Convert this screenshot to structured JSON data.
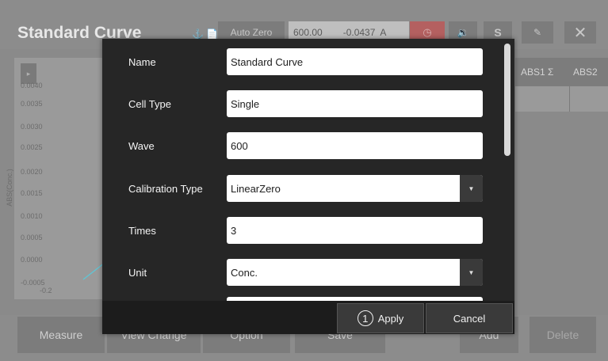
{
  "app": {
    "title": "Standard Curve",
    "header_icons": "⚓ 📄",
    "auto_zero_label": "Auto Zero",
    "wavelength_value": "600.00",
    "abs_value": "-0.0437",
    "abs_unit": "A",
    "sound_icon": "🔉",
    "s_label": "S",
    "close_glyph": "✕",
    "clock_icon": "◷",
    "edit_icon": "✎"
  },
  "chart": {
    "y_axis_label": "ABS(Conc.)",
    "y_ticks": [
      "0.0040",
      "0.0035",
      "0.0030",
      "0.0025",
      "0.0020",
      "0.0015",
      "0.0010",
      "0.0005",
      "0.0000",
      "-0.0005"
    ],
    "x_tick": "-0.2",
    "play_glyph": "▸",
    "line_color": "#5bc8d8"
  },
  "table": {
    "columns": [
      "ABS1 Σ",
      "ABS2"
    ]
  },
  "bottom_bar": {
    "measure": "Measure",
    "view_change": "View Change",
    "option": "Option",
    "save": "Save",
    "add": "Add",
    "delete": "Delete"
  },
  "dialog": {
    "fields": [
      {
        "label": "Name",
        "value": "Standard Curve"
      },
      {
        "label": "Cell Type",
        "value": "Single"
      },
      {
        "label": "Wave",
        "value": "600"
      },
      {
        "label": "Calibration Type",
        "value": "LinearZero"
      },
      {
        "label": "Times",
        "value": "3"
      },
      {
        "label": "Unit",
        "value": "Conc."
      }
    ],
    "dropdown_glyph": "▼",
    "apply_badge": "1",
    "apply_label": "Apply",
    "cancel_label": "Cancel"
  }
}
